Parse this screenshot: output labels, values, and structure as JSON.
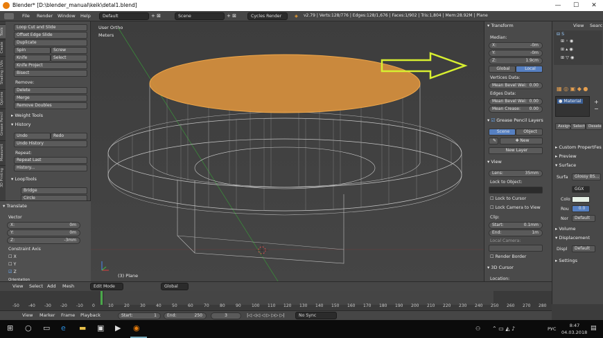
{
  "window": {
    "title": "Blender* [D:\\blender_manual\\keik\\detal1.blend]",
    "minimize": "—",
    "maximize": "☐",
    "close": "✕"
  },
  "menu": {
    "file": "File",
    "render": "Render",
    "window": "Window",
    "help": "Help",
    "layout": "Default",
    "scene": "Scene",
    "engine": "Cycles Render",
    "stats": "v2.79 | Verts:128/776 | Edges:128/1,676 | Faces:1/902 | Tris:1,804 | Mem:28.92M | Plane"
  },
  "left_tabs": [
    "Tools",
    "Create",
    "Shading / UVs",
    "Options",
    "Grease Pencil",
    "Measureit",
    "3D Printing"
  ],
  "tools": {
    "loop_cut": "Loop Cut and Slide",
    "offset_edge": "Offset Edge Slide",
    "duplicate": "Duplicate",
    "spin": "Spin",
    "screw": "Screw",
    "knife": "Knife",
    "select": "Select",
    "knife_project": "Knife Project",
    "bisect": "Bisect",
    "remove_label": "Remove:",
    "delete": "Delete",
    "merge": "Merge",
    "remove_doubles": "Remove Doubles",
    "weight_tools": "Weight Tools",
    "history": "History",
    "undo": "Undo",
    "redo": "Redo",
    "undo_history": "Undo History",
    "repeat_label": "Repeat:",
    "repeat_last": "Repeat Last",
    "history_btn": "History...",
    "looptools": "LoopTools",
    "bridge": "Bridge",
    "circle": "Circle"
  },
  "operator": {
    "title": "Translate",
    "vector": "Vector",
    "x_label": "X:",
    "x": "0m",
    "y_label": "Y:",
    "y": "0m",
    "z_label": "Z:",
    "z": "-3mm",
    "constraint": "Constraint Axis",
    "cx": "X",
    "cy": "Y",
    "cz": "Z",
    "orientation": "Orientation"
  },
  "viewport": {
    "view": "User Ortho",
    "units": "Meters",
    "object": "(3) Plane"
  },
  "npanel": {
    "transform": "Transform",
    "median": "Median:",
    "x_label": "X:",
    "x": "-0m",
    "y_label": "Y:",
    "y": "-0m",
    "z_label": "Z:",
    "z": "1.9cm",
    "global": "Global",
    "local": "Local",
    "vertices_data": "Vertices Data:",
    "mean_bevel_w": "Mean Bevel Wei:",
    "mbw_val": "0.00",
    "edges_data": "Edges Data:",
    "mean_bevel_w2": "Mean Bevel Wei:",
    "mbw2_val": "0.00",
    "mean_crease": "Mean Crease:",
    "mc_val": "0.00",
    "gp_layers": "Grease Pencil Layers",
    "scene": "Scene",
    "object": "Object",
    "new": "New",
    "new_layer": "New Layer",
    "view": "View",
    "lens_label": "Lens:",
    "lens": "35mm",
    "lock_to_object": "Lock to Object:",
    "lock_cursor": "Lock to Cursor",
    "lock_camera": "Lock Camera to View",
    "clip": "Clip:",
    "start_label": "Start:",
    "start": "0.1mm",
    "end_label": "End:",
    "end": "1m",
    "local_camera": "Local Camera:",
    "render_border": "Render Border",
    "cursor": "3D Cursor",
    "location": "Location:"
  },
  "outliner": {
    "view": "View",
    "search": "Searc"
  },
  "properties": {
    "material": "Material",
    "assign": "Assign",
    "select": "Select",
    "deselect": "Desele",
    "custom_props": "Custom PropertFes",
    "preview": "Preview",
    "surface": "Surface",
    "surf_label": "Surfa",
    "surf_val": "Glossy BS...",
    "ggx": "GGX",
    "color_label": "Colo",
    "rough_label": "Rou",
    "rough_val": "0.0",
    "normal_label": "Nor",
    "normal_val": "Default",
    "volume": "Volume",
    "displacement": "Displacement",
    "displ_label": "Displ",
    "displ_val": "Default",
    "settings": "Settings"
  },
  "view3d_header": {
    "view": "View",
    "select": "Select",
    "add": "Add",
    "mesh": "Mesh",
    "mode": "Edit Mode",
    "orientation": "Global"
  },
  "timeline": {
    "ticks": [
      "-50",
      "-40",
      "-30",
      "-20",
      "-10",
      "0",
      "10",
      "20",
      "30",
      "40",
      "50",
      "60",
      "70",
      "80",
      "90",
      "100",
      "110",
      "120",
      "130",
      "140",
      "150",
      "160",
      "170",
      "180",
      "190",
      "200",
      "210",
      "220",
      "230",
      "240",
      "250",
      "260",
      "270",
      "280"
    ],
    "view": "View",
    "marker": "Marker",
    "frame": "Frame",
    "playback": "Playback",
    "start_label": "Start:",
    "start": "1",
    "end_label": "End:",
    "end": "250",
    "current": "3",
    "sync": "No Sync"
  },
  "taskbar": {
    "lang": "РУС",
    "time": "8:47",
    "date": "04.03.2018"
  }
}
